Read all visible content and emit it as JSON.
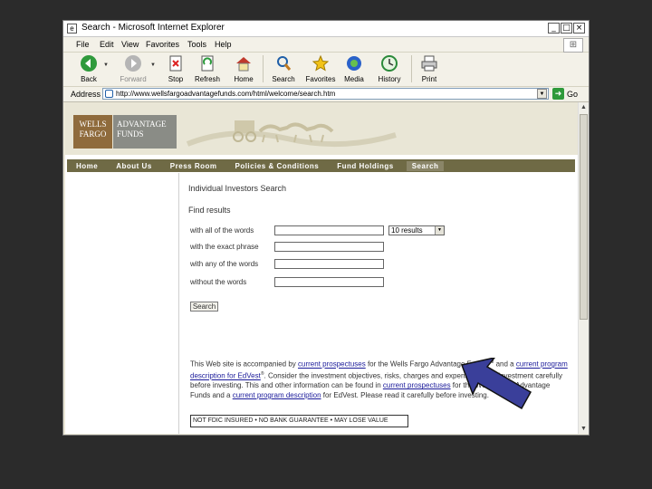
{
  "window": {
    "title": "Search - Microsoft Internet Explorer",
    "controls": [
      "_",
      "□",
      "×"
    ]
  },
  "menu": [
    "File",
    "Edit",
    "View",
    "Favorites",
    "Tools",
    "Help"
  ],
  "toolbar": {
    "back": "Back",
    "forward": "Forward",
    "stop": "Stop",
    "refresh": "Refresh",
    "home": "Home",
    "search": "Search",
    "favorites": "Favorites",
    "media": "Media",
    "history": "History",
    "print": "Print"
  },
  "address": {
    "label": "Address",
    "url": "http://www.wellsfargoadvantagefunds.com/html/welcome/search.htm",
    "go": "Go"
  },
  "site": {
    "logo_left": [
      "WELLS",
      "FARGO"
    ],
    "logo_right": [
      "ADVANTAGE",
      "FUNDS"
    ],
    "nav": [
      "Home",
      "About Us",
      "Press Room",
      "Policies & Conditions",
      "Fund Holdings",
      "Search"
    ]
  },
  "search": {
    "title": "Individual Investors Search",
    "find_results": "Find results",
    "all_words": "with all of the words",
    "exact_phrase": "with the exact phrase",
    "any_words": "with any of the words",
    "without_words": "without the words",
    "results_option": "10 results",
    "button": "Search"
  },
  "disclaimer": {
    "p1": "This Web site is accompanied by ",
    "link1": "current prospectuses",
    "p2": " for the Wells Fargo Advantage Funds",
    "sm": "SM",
    "p3": " and a ",
    "link2": "current program description for EdVest",
    "reg": "®",
    "p4": ". Consider the investment objectives, risks, charges and expenses of the investment carefully before investing. This and other information can be found in ",
    "link3": "current prospectuses",
    "p5": " for the Wells Fargo Advantage Funds and a ",
    "link4": "current program description",
    "p6": " for EdVest. Please read it carefully before investing."
  },
  "insurance": "NOT FDIC INSURED • NO BANK GUARANTEE • MAY LOSE VALUE",
  "colors": {
    "nav_bg": "#6f6a45",
    "logo_left": "#8f6b3c",
    "logo_right": "#8a8c86",
    "arrow_fill": "#3a3f9a"
  }
}
